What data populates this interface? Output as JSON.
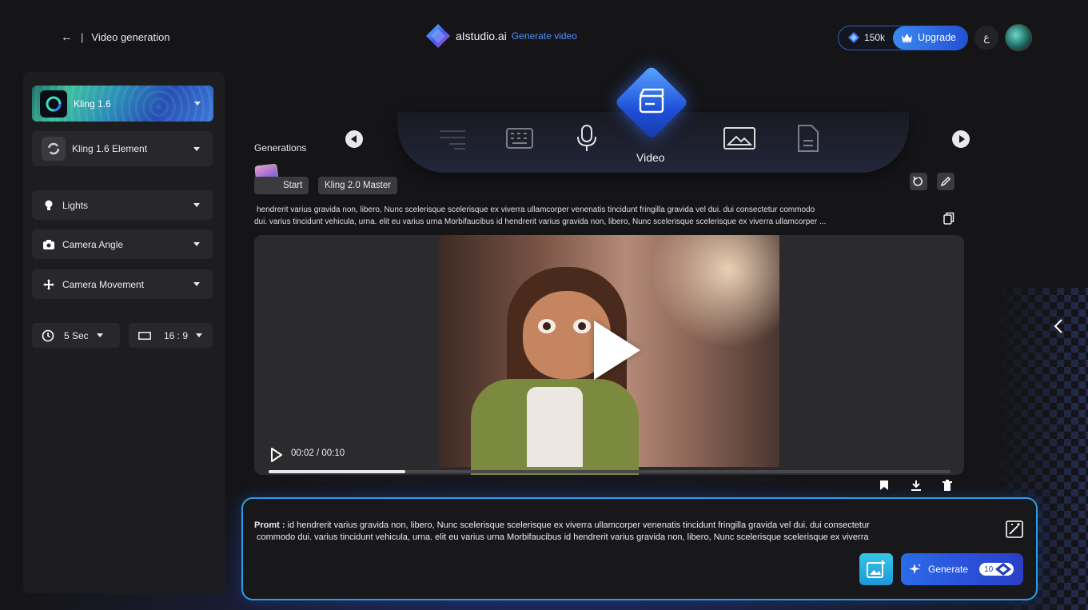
{
  "header": {
    "back_label": "Video generation",
    "brand": "aIstudio.ai",
    "brand_sub": "Generate video",
    "credits": "150k",
    "upgrade_label": "Upgrade",
    "language_glyph": "ع"
  },
  "sidebar": {
    "model": "Kling 1.6",
    "element": "Kling 1.6 Element",
    "options": [
      {
        "label": "Lights",
        "icon": "bulb-icon"
      },
      {
        "label": "Camera Angle",
        "icon": "camera-icon"
      },
      {
        "label": "Camera Movement",
        "icon": "move-icon"
      }
    ],
    "duration": "5 Sec",
    "ratio": "16 : 9"
  },
  "generations": {
    "label": "Generations",
    "active_tab": "Video",
    "tab_icons": [
      "text-icon",
      "keyboard-icon",
      "microphone-icon",
      "video-icon",
      "image-icon",
      "document-icon"
    ]
  },
  "current": {
    "start_chip": "Start",
    "model_chip": "Kling 2.0 Master",
    "prompt_preview_1": "hendrerit varius gravida non, libero, Nunc scelerisque scelerisque ex viverra ullamcorper venenatis tincidunt fringilla gravida vel dui. dui consectetur commodo",
    "prompt_preview_2": "dui. varius tincidunt vehicula, urna. elit eu varius urna Morbifaucibus id hendrerit varius gravida non, libero, Nunc scelerisque scelerisque ex viverra ullamcorper  ..."
  },
  "player": {
    "time": "00:02 / 00:10",
    "progress": 0.2
  },
  "prompt_box": {
    "label": "Promt :",
    "text_1": " id hendrerit varius gravida non, libero, Nunc scelerisque scelerisque ex viverra ullamcorper venenatis tincidunt fringilla gravida vel dui. dui consectetur",
    "text_2": "commodo dui. varius tincidunt vehicula, urna. elit eu varius urna Morbifaucibus id hendrerit varius gravida non, libero, Nunc scelerisque scelerisque ex viverra",
    "generate_label": "Generate",
    "generate_cost": "10"
  },
  "colors": {
    "accent": "#2a6be8",
    "border_glow": "#2a9fe6",
    "brand_sub": "#4f8fff"
  }
}
